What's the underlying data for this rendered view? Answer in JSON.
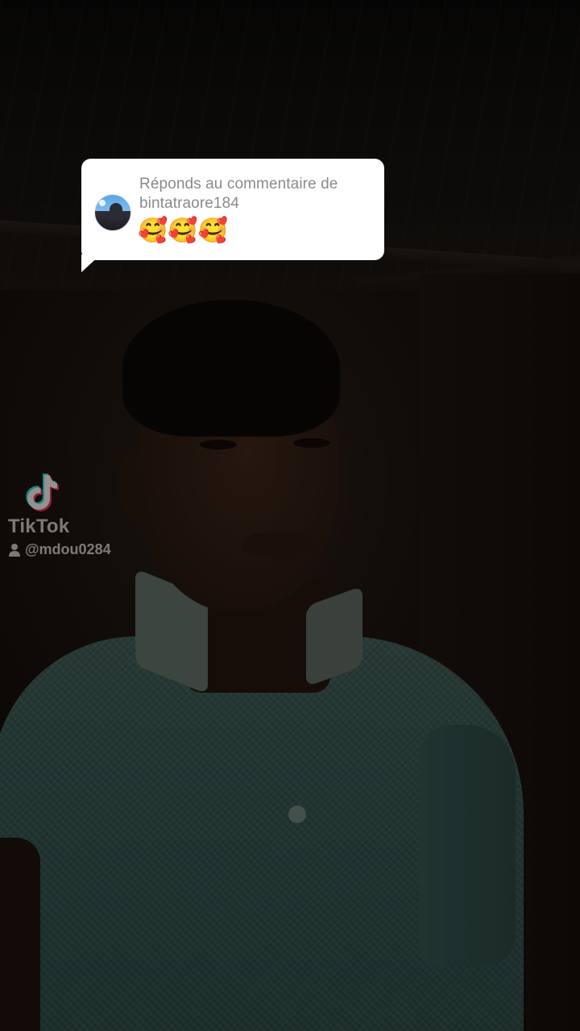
{
  "reply": {
    "title": "Réponds au commentaire de bintatraore184",
    "comment": "🥰🥰🥰"
  },
  "watermark": {
    "brand": "TikTok",
    "handle": "@mdou0284"
  },
  "colors": {
    "sticker_background": "#ffffff",
    "sticker_text": "#8a8a8a",
    "watermark_text": "rgba(255,255,255,0.45)",
    "tiktok_cyan": "#25f4ee",
    "tiktok_red": "#fe2c55"
  },
  "icons": {
    "watermark_logo": "tiktok-note-icon",
    "handle_prefix": "user-icon"
  }
}
